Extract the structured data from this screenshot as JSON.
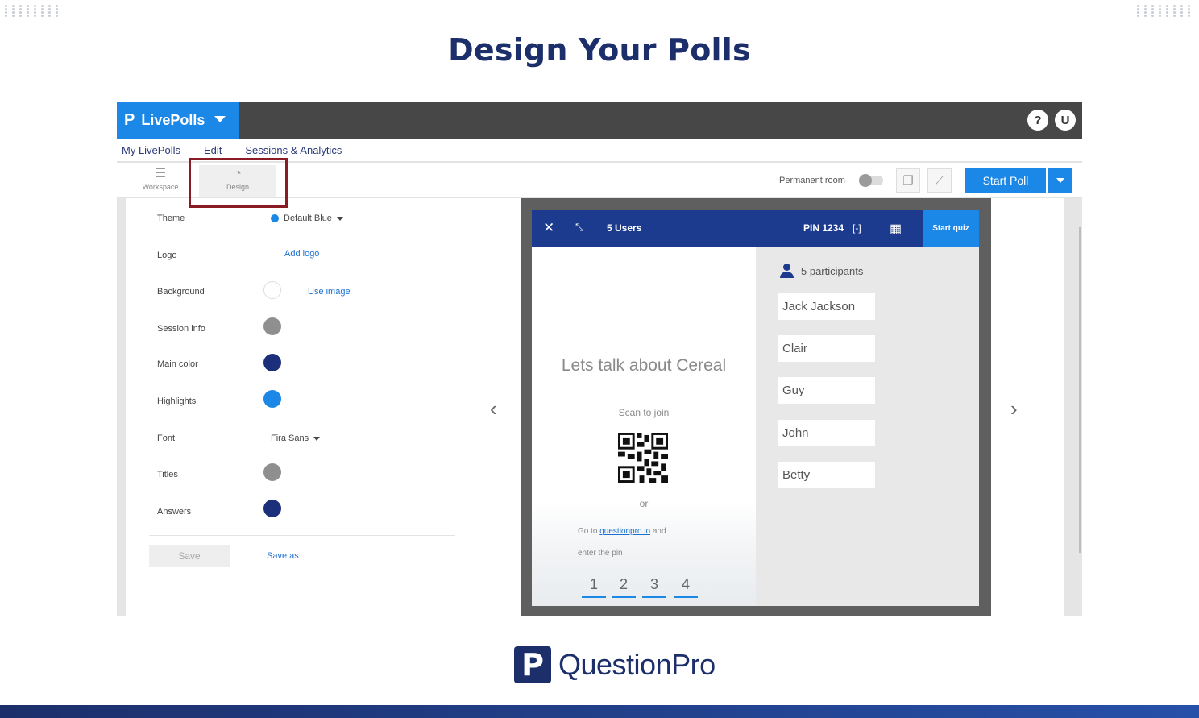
{
  "page": {
    "title": "Design Your Polls",
    "brand_name": "QuestionPro",
    "brand_mark": "P"
  },
  "app": {
    "logo_label": "LivePolls",
    "logo_mark": "P",
    "help_icon": "?",
    "user_initial": "U",
    "menu": [
      "My LivePolls",
      "Edit",
      "Sessions & Analytics"
    ],
    "tools": {
      "workspace": "Workspace",
      "design": "Design"
    },
    "permanent_room": "Permanent room",
    "start_poll": "Start Poll"
  },
  "settings": {
    "theme": {
      "label": "Theme",
      "value": "Default Blue"
    },
    "logo": {
      "label": "Logo",
      "action": "Add logo"
    },
    "background": {
      "label": "Background",
      "action": "Use image",
      "color": "#ffffff"
    },
    "session_info": {
      "label": "Session info",
      "color": "#8f8f8f"
    },
    "main_color": {
      "label": "Main color",
      "color": "#1c2f7a"
    },
    "highlights": {
      "label": "Highlights",
      "color": "#1b87e6"
    },
    "font": {
      "label": "Font",
      "value": "Fira Sans"
    },
    "titles": {
      "label": "Titles",
      "color": "#8f8f8f"
    },
    "answers": {
      "label": "Answers",
      "color": "#1c2f7a"
    },
    "save": "Save",
    "save_as": "Save as"
  },
  "preview": {
    "close_icon": "✕",
    "expand_icon": "⤡",
    "users": "5 Users",
    "pin": "PIN 1234",
    "pin_icon": "[-]",
    "qr_icon": "▦",
    "start_quiz": "Start quiz",
    "poll_title": "Lets talk about Cereal",
    "scan_to_join": "Scan to join",
    "or": "or",
    "go_to": "Go to",
    "site": "questionpro.io",
    "and": "and",
    "enter_pin": "enter the pin",
    "pin_digits": [
      "1",
      "2",
      "3",
      "4"
    ],
    "participants_label": "5 participants",
    "participants": [
      "Jack Jackson",
      "Clair",
      "Guy",
      "John",
      "Betty"
    ]
  },
  "colors": {
    "accent": "#1b87e6",
    "dark_blue": "#1c2f6b",
    "highlight_box": "#8a1a24"
  }
}
